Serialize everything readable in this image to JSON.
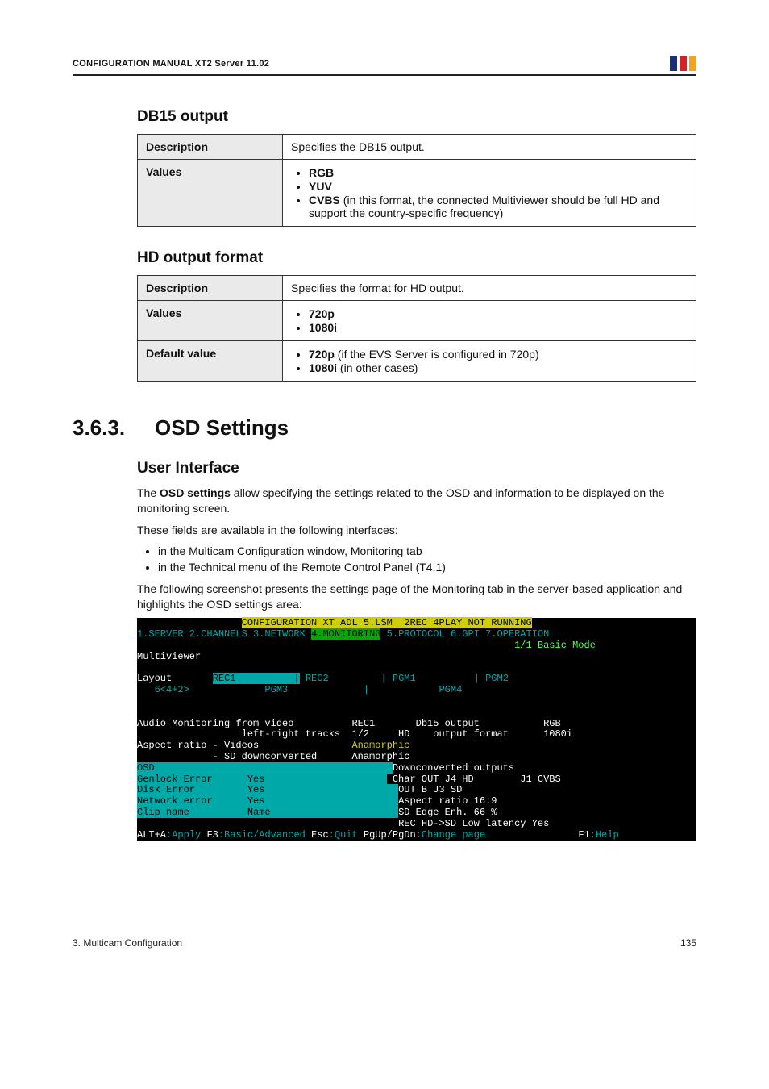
{
  "header": {
    "title": "CONFIGURATION MANUAL XT2 Server 11.02",
    "logo": "EVS"
  },
  "section_db15": {
    "title": "DB15 output",
    "row_desc_label": "Description",
    "row_desc_value": "Specifies the DB15 output.",
    "row_values_label": "Values",
    "values": {
      "v1": "RGB",
      "v2": "YUV",
      "v3_prefix": "CVBS",
      "v3_rest": " (in this format, the connected Multiviewer should be full HD and support the country-specific frequency)"
    }
  },
  "section_hd": {
    "title": "HD output format",
    "row_desc_label": "Description",
    "row_desc_value": "Specifies the format for HD output.",
    "row_values_label": "Values",
    "values": {
      "v1": "720p",
      "v2": "1080i"
    },
    "row_default_label": "Default value",
    "defaults": {
      "d1_prefix": "720p",
      "d1_rest": " (if the EVS Server is configured in 720p)",
      "d2_prefix": "1080i",
      "d2_rest": " (in other cases)"
    }
  },
  "chapter": {
    "num": "3.6.3.",
    "title": "OSD Settings"
  },
  "ui": {
    "title": "User Interface",
    "p1_a": "The ",
    "p1_b": "OSD settings",
    "p1_c": " allow specifying the settings related to the OSD and information to be displayed on the monitoring screen.",
    "p2": "These fields are available in the following interfaces:",
    "li1": "in the Multicam Configuration window, Monitoring tab",
    "li2": "in the Technical menu of the Remote Control Panel (T4.1)",
    "p3": "The following screenshot presents the settings page of the Monitoring tab in the server-based application and highlights the OSD settings area:"
  },
  "terminal": {
    "l1_a": "                  ",
    "l1_b": "CONFIGURATION XT ADL 5.LSM  2REC 4PLAY NOT RUNNING",
    "l2_tabs_a": "1.SERVER 2.CHANNELS 3.NETWORK ",
    "l2_tabs_b": "4.MONITORING",
    "l2_tabs_c": " 5.PROTOCOL 6.GPI 7.OPERATION",
    "l3_a": "                                                                 ",
    "l3_b": "1/1 Basic Mode",
    "l4": "Multiviewer",
    "l5": "",
    "l6_a": "Layout       ",
    "l6_b": "REC1          |",
    "l6_c": " REC2         |",
    "l6_d": " PGM1          |",
    "l6_e": " PGM2       ",
    "l7_a": "   6<4+2>             PGM3             |            PGM4",
    "l8_a": "Audio Monitoring from video          REC1       Db15 output           RGB",
    "l9_a": "                  left-right tracks  1/2     HD    output format      1080i",
    "l10_a": "Aspect ratio - Videos",
    "l10_b": "                Anamorphic",
    "l11_a": "             - SD downconverted      Anamorphic",
    "l12_a": "OSD                                         ",
    "l12_b": "Downconverted outputs",
    "l13_a": "Genlock Error      Yes                     ",
    "l13_b": " Char OUT J4 HD        J1 CVBS",
    "l14_a": "Disk Error         Yes                       ",
    "l14_b": "OUT B J3 SD",
    "l15_a": "Network error      Yes                       ",
    "l15_b": "Aspect ratio 16:9",
    "l16_a": "Clip name          Name                      ",
    "l16_b": "SD Edge Enh. 66 %",
    "l17_a": "                                             ",
    "l17_b": "REC HD->SD Low latency Yes",
    "l18_a": "ALT+A",
    "l18_b": ":Apply ",
    "l18_c": "F3",
    "l18_d": ":Basic/Advanced ",
    "l18_e": "Esc",
    "l18_f": ":Quit ",
    "l18_g": "PgUp/PgDn",
    "l18_h": ":Change page                ",
    "l18_i": "F1",
    "l18_j": ":Help"
  },
  "footer": {
    "left": "3. Multicam Configuration",
    "right": "135"
  }
}
